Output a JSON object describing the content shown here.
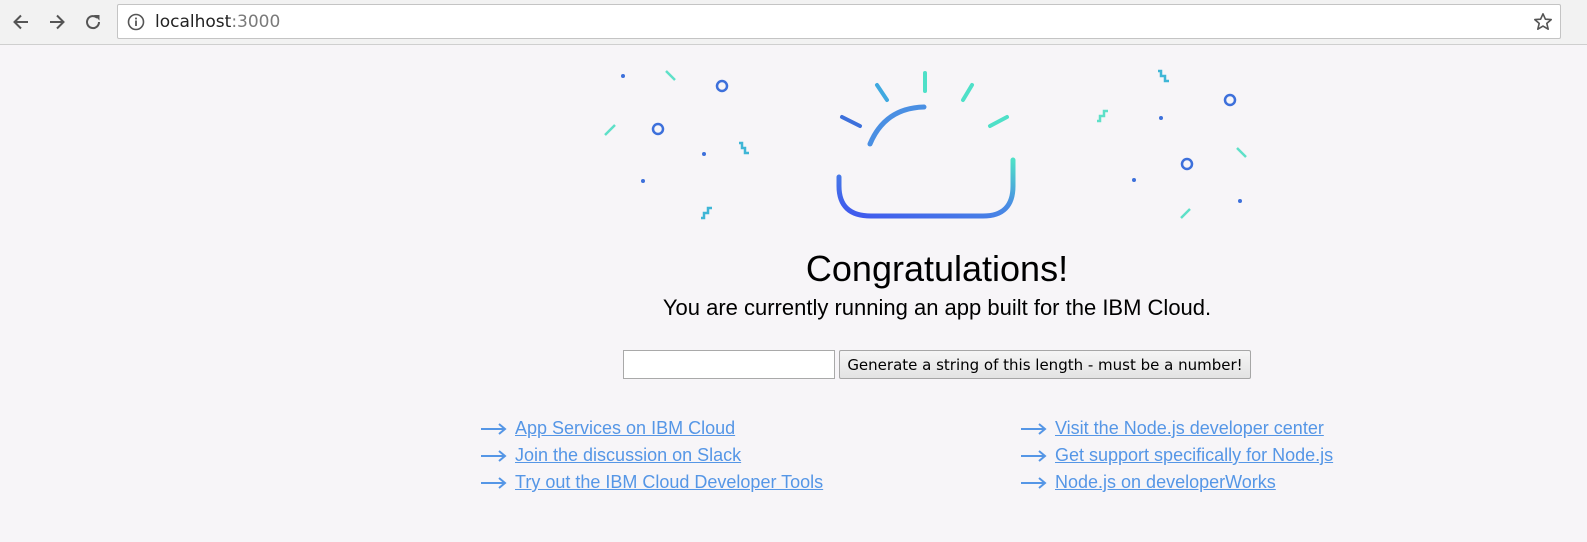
{
  "browser": {
    "url_host": "localhost",
    "url_port": ":3000",
    "icons": {
      "back": "arrow-left-icon",
      "forward": "arrow-right-icon",
      "reload": "reload-icon",
      "info": "info-icon",
      "bookmark": "star-icon"
    }
  },
  "page": {
    "heading": "Congratulations!",
    "subheading": "You are currently running an app built for the IBM Cloud.",
    "length_input": {
      "value": "",
      "placeholder": ""
    },
    "generate_button": "Generate a string of this length - must be a number!",
    "links_left": [
      {
        "label": "App Services on IBM Cloud"
      },
      {
        "label": "Join the discussion on Slack"
      },
      {
        "label": "Try out the IBM Cloud Developer Tools"
      }
    ],
    "links_right": [
      {
        "label": "Visit the Node.js developer center"
      },
      {
        "label": "Get support specifically for Node.js"
      },
      {
        "label": "Node.js on developerWorks"
      }
    ]
  },
  "colors": {
    "link": "#5596e6",
    "confetti_teal": "#5ee0c8",
    "confetti_blue": "#3d70db",
    "cloud_gradient_start": "#3f55ee",
    "cloud_gradient_end": "#4fe0c8"
  }
}
